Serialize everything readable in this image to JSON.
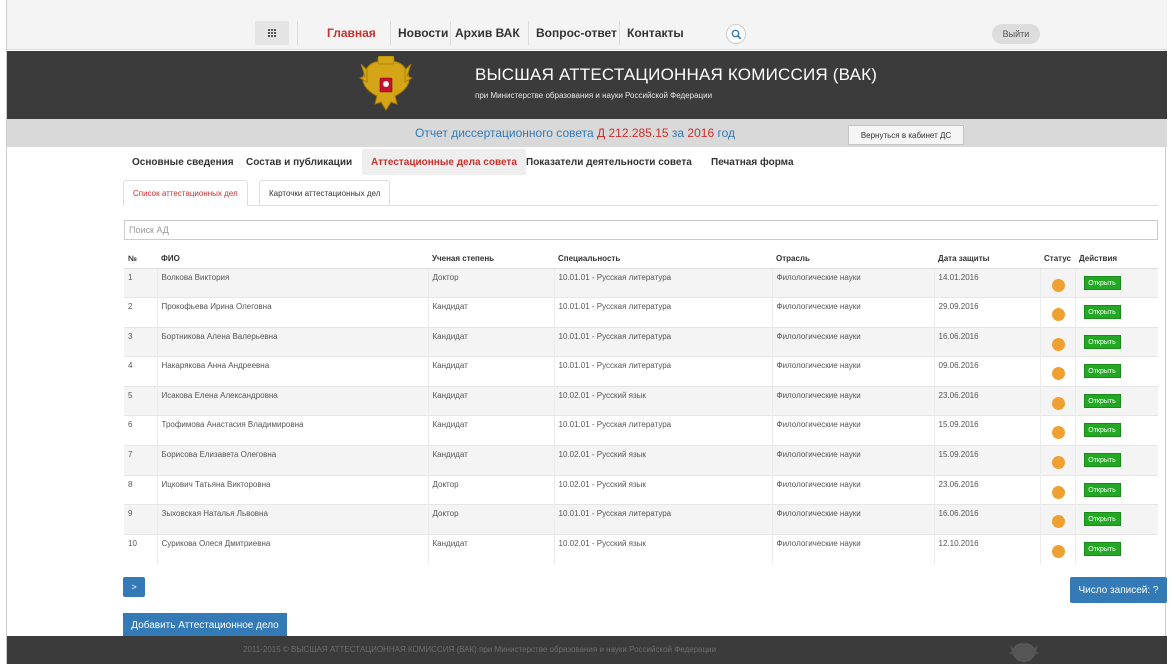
{
  "nav": {
    "items": [
      "Главная",
      "Новости",
      "Архив ВАК",
      "Вопрос-ответ",
      "Контакты"
    ],
    "logout_label": "Выйти"
  },
  "header": {
    "title": "ВЫСШАЯ АТТЕСТАЦИОННАЯ КОМИССИЯ (ВАК)",
    "subtitle": "при Министерстве образования и науки Российской Федерации"
  },
  "report": {
    "prefix": "Отчет диссертационного совета",
    "council": "Д 212.285.15",
    "middle": "за",
    "year": "2016",
    "suffix": "год",
    "back_label": "Вернуться в кабинет ДС"
  },
  "main_tabs": [
    "Основные сведения",
    "Состав и публикации",
    "Аттестационные дела совета",
    "Показатели деятельности совета",
    "Печатная форма"
  ],
  "sub_tabs": [
    "Список аттестационных дел",
    "Карточки аттестационных дел"
  ],
  "search": {
    "placeholder": "Поиск АД"
  },
  "table": {
    "headers": [
      "№",
      "ФИО",
      "Ученая степень",
      "Специальность",
      "Отрасль",
      "Дата защиты",
      "Статус",
      "Действия"
    ],
    "open_label": "Открыть",
    "status_color": "#f0a030",
    "rows": [
      [
        "1",
        "Волкова Виктория",
        "Доктор",
        "10.01.01 - Русская литература",
        "Филологические науки",
        "14.01.2016"
      ],
      [
        "2",
        "Прокофьева Ирина Олеговна",
        "Кандидат",
        "10.01.01 - Русская литература",
        "Филологические науки",
        "29.09.2016"
      ],
      [
        "3",
        "Бортникова Алена Валерьевна",
        "Кандидат",
        "10.01.01 - Русская литература",
        "Филологические науки",
        "16.06.2016"
      ],
      [
        "4",
        "Накарякова Анна Андреевна",
        "Кандидат",
        "10.01.01 - Русская литература",
        "Филологические науки",
        "09.06.2016"
      ],
      [
        "5",
        "Исакова Елена Александровна",
        "Кандидат",
        "10.02.01 - Русский язык",
        "Филологические науки",
        "23.06.2016"
      ],
      [
        "6",
        "Трофимова Анастасия Владимировна",
        "Кандидат",
        "10.01.01 - Русская литература",
        "Филологические науки",
        "15.09.2016"
      ],
      [
        "7",
        "Борисова Елизавета Олеговна",
        "Кандидат",
        "10.02.01 - Русский язык",
        "Филологические науки",
        "15.09.2016"
      ],
      [
        "8",
        "Ицкович Татьяна Викторовна",
        "Доктор",
        "10.02.01 - Русский язык",
        "Филологические науки",
        "23.06.2016"
      ],
      [
        "9",
        "Зыховская Наталья Львовна",
        "Доктор",
        "10.01.01 - Русская литература",
        "Филологические науки",
        "16.06.2016"
      ],
      [
        "10",
        "Сурикова Олеся Дмитриевна",
        "Кандидат",
        "10.02.01 - Русский язык",
        "Филологические науки",
        "12.10.2016"
      ]
    ]
  },
  "pager": {
    "next_label": ">"
  },
  "records_label": "Число записей: ?",
  "add_label": "Добавить Аттестационное дело",
  "footer": {
    "text": "2011-2015 © ВЫСШАЯ АТТЕСТАЦИОННАЯ КОМИССИЯ (ВАК) при Министерстве образования и науки Российской Федерации"
  },
  "colors": {
    "accent_red": "#c9302c",
    "primary_blue": "#337ab7",
    "open_green": "#22a822",
    "header_dark": "#3b3b3b"
  }
}
